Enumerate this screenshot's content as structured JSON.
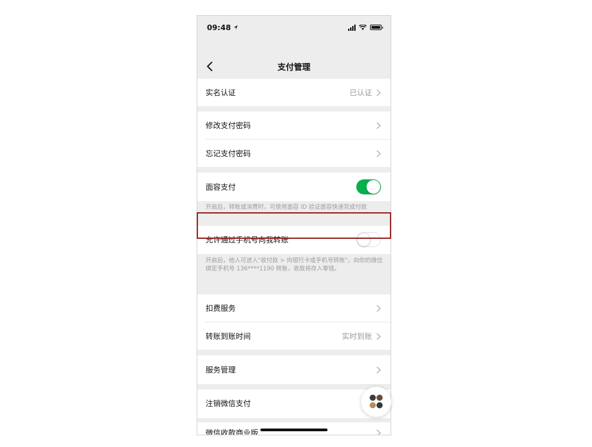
{
  "status_bar": {
    "time": "09:48"
  },
  "navbar": {
    "title": "支付管理"
  },
  "rows": {
    "real_name": {
      "label": "实名认证",
      "value": "已认证"
    },
    "change_password": {
      "label": "修改支付密码"
    },
    "forgot_password": {
      "label": "忘记支付密码"
    },
    "face_pay": {
      "label": "面容支付",
      "enabled": true
    },
    "face_pay_note": "开启后，转账或消费时，可使用面容 ID 验证面容快速完成付款",
    "phone_transfer": {
      "label": "允许通过手机号向我转账",
      "enabled": false
    },
    "phone_transfer_note": "开启后，他人可进入\"收付款 > 向银行卡或手机号转账\"，向你的微信绑定手机号 136****1190 转账，收款将存入零钱。",
    "deduction": {
      "label": "扣费服务"
    },
    "arrival_time": {
      "label": "转账到账时间",
      "value": "实时到账"
    },
    "service_mgmt": {
      "label": "服务管理"
    },
    "cancel_pay": {
      "label": "注销微信支付"
    },
    "merchant": {
      "label": "微信收款商业版"
    }
  },
  "colors": {
    "toggle_on": "#07b04a",
    "highlight_border": "#9c2b2b",
    "background": "#ededed"
  },
  "icons": [
    "back-arrow-icon",
    "chevron-right-icon",
    "signal-icon",
    "wifi-icon",
    "battery-icon",
    "location-arrow-icon",
    "floating-window-icon"
  ]
}
